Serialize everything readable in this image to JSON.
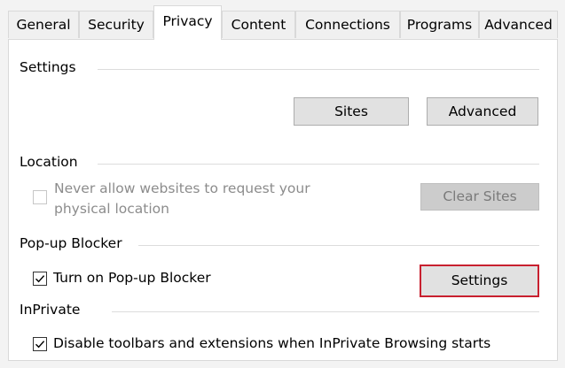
{
  "tabs": [
    {
      "label": "General",
      "active": false
    },
    {
      "label": "Security",
      "active": false
    },
    {
      "label": "Privacy",
      "active": true
    },
    {
      "label": "Content",
      "active": false
    },
    {
      "label": "Connections",
      "active": false
    },
    {
      "label": "Programs",
      "active": false
    },
    {
      "label": "Advanced",
      "active": false
    }
  ],
  "settings": {
    "heading": "Settings",
    "sites_button": "Sites",
    "advanced_button": "Advanced"
  },
  "location": {
    "heading": "Location",
    "never_allow_line1": "Never allow websites to request your",
    "never_allow_line2": "physical location",
    "never_allow_checked": false,
    "clear_sites_button": "Clear Sites"
  },
  "popup": {
    "heading": "Pop-up Blocker",
    "turn_on_label": "Turn on Pop-up Blocker",
    "turn_on_checked": true,
    "settings_button": "Settings"
  },
  "inprivate": {
    "heading": "InPrivate",
    "disable_label": "Disable toolbars and extensions when InPrivate Browsing starts",
    "disable_checked": true
  },
  "colors": {
    "focus_border": "#c8202f",
    "panel_bg": "#ffffff",
    "window_bg": "#f3f3f3"
  }
}
